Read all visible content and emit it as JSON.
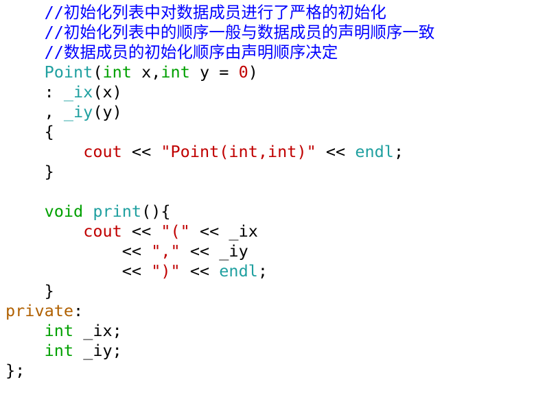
{
  "code_lines": [
    [
      {
        "t": "    ",
        "k": "plain"
      },
      {
        "t": "//初始化列表中对数据成员进行了严格的初始化",
        "k": "comment"
      }
    ],
    [
      {
        "t": "    ",
        "k": "plain"
      },
      {
        "t": "//初始化列表中的顺序一般与数据成员的声明顺序一致",
        "k": "comment"
      }
    ],
    [
      {
        "t": "    ",
        "k": "plain"
      },
      {
        "t": "//数据成员的初始化顺序由声明顺序决定",
        "k": "comment"
      }
    ],
    [
      {
        "t": "    ",
        "k": "plain"
      },
      {
        "t": "Point",
        "k": "func"
      },
      {
        "t": "(",
        "k": "plain"
      },
      {
        "t": "int",
        "k": "type"
      },
      {
        "t": " x,",
        "k": "plain"
      },
      {
        "t": "int",
        "k": "type"
      },
      {
        "t": " y = ",
        "k": "plain"
      },
      {
        "t": "0",
        "k": "number"
      },
      {
        "t": ")",
        "k": "plain"
      }
    ],
    [
      {
        "t": "    : ",
        "k": "plain"
      },
      {
        "t": "_ix",
        "k": "member"
      },
      {
        "t": "(x)",
        "k": "plain"
      }
    ],
    [
      {
        "t": "    , ",
        "k": "plain"
      },
      {
        "t": "_iy",
        "k": "member"
      },
      {
        "t": "(y)",
        "k": "plain"
      }
    ],
    [
      {
        "t": "    {",
        "k": "plain"
      }
    ],
    [
      {
        "t": "        ",
        "k": "plain"
      },
      {
        "t": "cout",
        "k": "stream"
      },
      {
        "t": " << ",
        "k": "plain"
      },
      {
        "t": "\"Point(int,int)\"",
        "k": "string"
      },
      {
        "t": " << ",
        "k": "plain"
      },
      {
        "t": "endl",
        "k": "func"
      },
      {
        "t": ";",
        "k": "plain"
      }
    ],
    [
      {
        "t": "    }",
        "k": "plain"
      }
    ],
    [
      {
        "t": "",
        "k": "plain"
      }
    ],
    [
      {
        "t": "    ",
        "k": "plain"
      },
      {
        "t": "void",
        "k": "type"
      },
      {
        "t": " ",
        "k": "plain"
      },
      {
        "t": "print",
        "k": "func"
      },
      {
        "t": "(){",
        "k": "plain"
      }
    ],
    [
      {
        "t": "        ",
        "k": "plain"
      },
      {
        "t": "cout",
        "k": "stream"
      },
      {
        "t": " << ",
        "k": "plain"
      },
      {
        "t": "\"(\"",
        "k": "string"
      },
      {
        "t": " << _ix",
        "k": "plain"
      }
    ],
    [
      {
        "t": "            << ",
        "k": "plain"
      },
      {
        "t": "\",\"",
        "k": "string"
      },
      {
        "t": " << _iy",
        "k": "plain"
      }
    ],
    [
      {
        "t": "            << ",
        "k": "plain"
      },
      {
        "t": "\")\"",
        "k": "string"
      },
      {
        "t": " << ",
        "k": "plain"
      },
      {
        "t": "endl",
        "k": "func"
      },
      {
        "t": ";",
        "k": "plain"
      }
    ],
    [
      {
        "t": "    }",
        "k": "plain"
      }
    ],
    [
      {
        "t": "private",
        "k": "access"
      },
      {
        "t": ":",
        "k": "plain"
      }
    ],
    [
      {
        "t": "    ",
        "k": "plain"
      },
      {
        "t": "int",
        "k": "type"
      },
      {
        "t": " _ix;",
        "k": "plain"
      }
    ],
    [
      {
        "t": "    ",
        "k": "plain"
      },
      {
        "t": "int",
        "k": "type"
      },
      {
        "t": " _iy;",
        "k": "plain"
      }
    ],
    [
      {
        "t": "};",
        "k": "plain"
      }
    ]
  ],
  "colors": {
    "comment": "#0000ff",
    "type": "#00a000",
    "func": "#20a0a0",
    "member": "#20a0a0",
    "string": "#c00000",
    "number": "#c00000",
    "stream": "#c00000",
    "access": "#b06000",
    "plain": "#000000"
  }
}
